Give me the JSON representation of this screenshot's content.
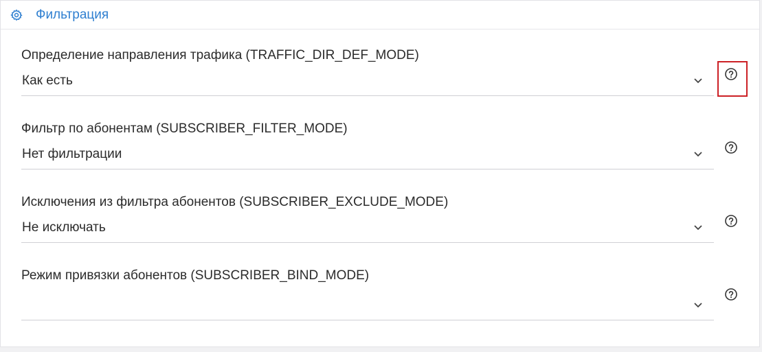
{
  "panel": {
    "title": "Фильтрация",
    "icon": "gear-icon",
    "accent_color": "#2f7fd0"
  },
  "fields": [
    {
      "label": "Определение направления трафика (TRAFFIC_DIR_DEF_MODE)",
      "value": "Как есть",
      "help_icon": "question-circle-icon",
      "highlighted": true
    },
    {
      "label": "Фильтр по абонентам (SUBSCRIBER_FILTER_MODE)",
      "value": "Нет фильтрации",
      "help_icon": "question-circle-icon"
    },
    {
      "label": "Исключения из фильтра абонентов (SUBSCRIBER_EXCLUDE_MODE)",
      "value": "Не исключать",
      "help_icon": "question-circle-icon"
    },
    {
      "label": "Режим привязки абонентов (SUBSCRIBER_BIND_MODE)",
      "value": "",
      "help_icon": "question-circle-icon"
    }
  ],
  "highlight_color": "#cc1f24"
}
